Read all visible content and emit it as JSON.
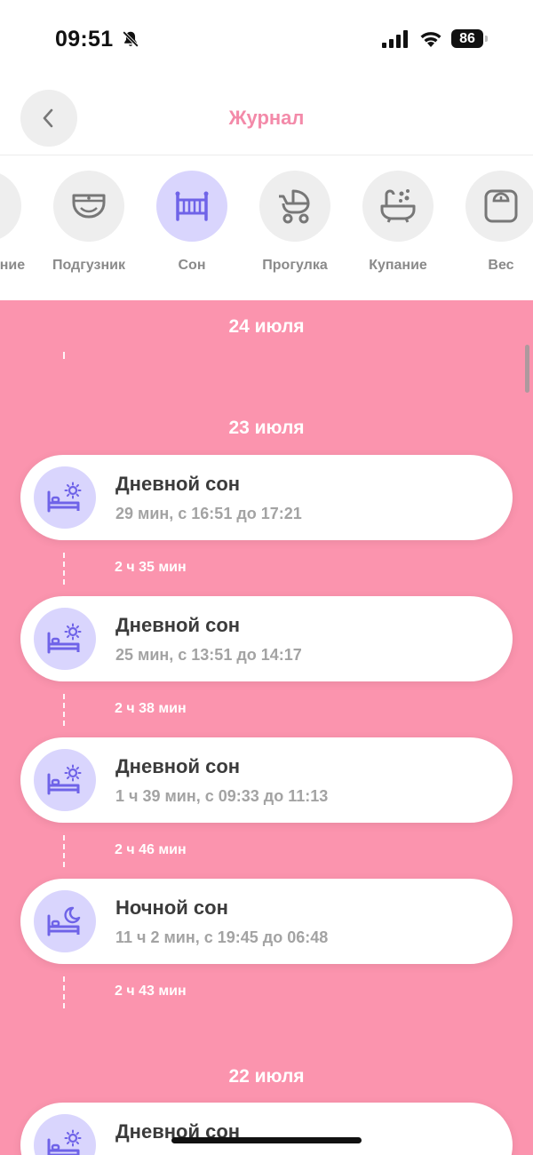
{
  "status_bar": {
    "time": "09:51",
    "battery": "86"
  },
  "header": {
    "title": "Журнал",
    "back_icon": "chevron-left-icon"
  },
  "categories": [
    {
      "label": "Кормление",
      "icon": "feeding-icon",
      "active": false
    },
    {
      "label": "Подгузник",
      "icon": "diaper-icon",
      "active": false
    },
    {
      "label": "Сон",
      "icon": "crib-icon",
      "active": true
    },
    {
      "label": "Прогулка",
      "icon": "stroller-icon",
      "active": false
    },
    {
      "label": "Купание",
      "icon": "bathtub-icon",
      "active": false
    },
    {
      "label": "Вес",
      "icon": "scale-icon",
      "active": false
    }
  ],
  "feed": {
    "groups": [
      {
        "date": "24 июля",
        "entries": []
      },
      {
        "date": "23 июля",
        "entries": [
          {
            "title": "Дневной сон",
            "details": "29 мин, с 16:51 до 17:21",
            "icon": "bed-sun-icon",
            "gap": "2 ч 35 мин"
          },
          {
            "title": "Дневной сон",
            "details": "25 мин, с 13:51 до 14:17",
            "icon": "bed-sun-icon",
            "gap": "2 ч 38 мин"
          },
          {
            "title": "Дневной сон",
            "details": "1 ч 39 мин, с 09:33 до 11:13",
            "icon": "bed-sun-icon",
            "gap": "2 ч 46 мин"
          },
          {
            "title": "Ночной сон",
            "details": "11 ч 2 мин, с 19:45 до 06:48",
            "icon": "bed-moon-icon",
            "gap": "2 ч 43 мин"
          }
        ]
      },
      {
        "date": "22 июля",
        "entries": [
          {
            "title": "Дневной сон",
            "details": "",
            "icon": "bed-sun-icon"
          }
        ]
      }
    ]
  },
  "colors": {
    "accent": "#f38aa9",
    "feed_background": "#fb94ae",
    "active_icon_bg": "#d9d5fd",
    "icon_purple": "#6f63e8"
  }
}
